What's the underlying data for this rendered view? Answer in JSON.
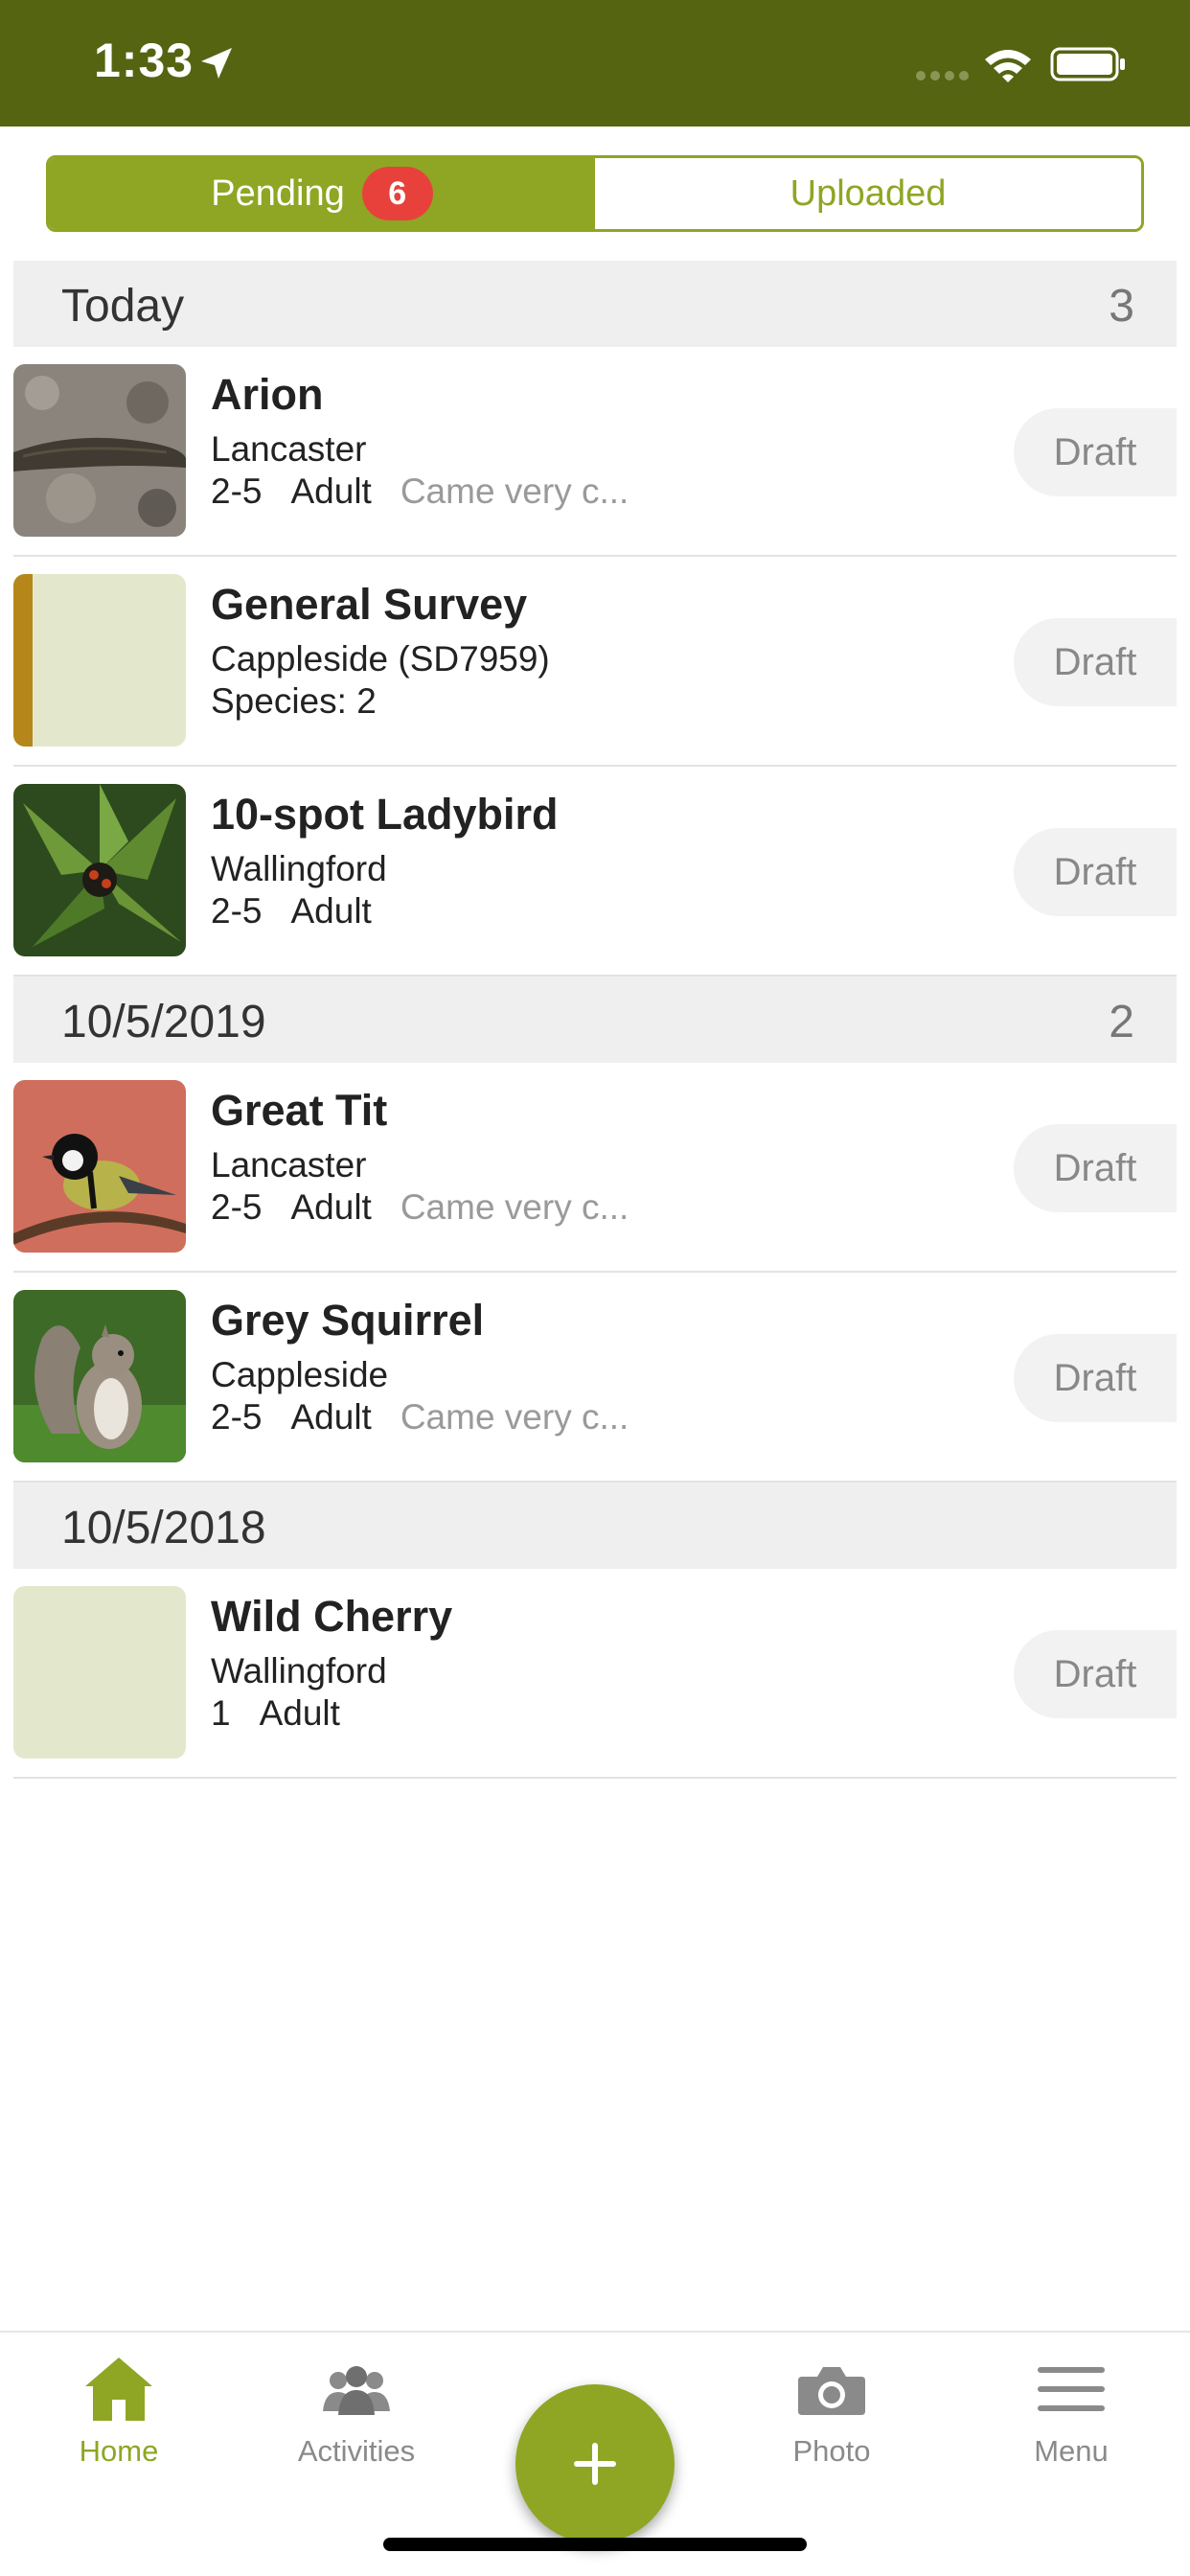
{
  "status_bar": {
    "time": "1:33"
  },
  "tabs": {
    "pending_label": "Pending",
    "pending_count": "6",
    "uploaded_label": "Uploaded"
  },
  "sections": [
    {
      "title": "Today",
      "count": "3"
    },
    {
      "title": "10/5/2019",
      "count": "2"
    },
    {
      "title": "10/5/2018",
      "count": ""
    }
  ],
  "records": [
    {
      "title": "Arion",
      "location": "Lancaster",
      "count": "2-5",
      "stage": "Adult",
      "comment": "Came very c...",
      "status": "Draft"
    },
    {
      "title": "General Survey",
      "location": "Cappleside (SD7959)",
      "species": "Species: 2",
      "status": "Draft"
    },
    {
      "title": "10-spot Ladybird",
      "location": "Wallingford",
      "count": "2-5",
      "stage": "Adult",
      "status": "Draft"
    },
    {
      "title": "Great Tit",
      "location": "Lancaster",
      "count": "2-5",
      "stage": "Adult",
      "comment": "Came very c...",
      "status": "Draft"
    },
    {
      "title": "Grey Squirrel",
      "location": "Cappleside",
      "count": "2-5",
      "stage": "Adult",
      "comment": "Came very c...",
      "status": "Draft"
    },
    {
      "title": "Wild Cherry",
      "location": "Wallingford",
      "count": "1",
      "stage": "Adult",
      "status": "Draft"
    }
  ],
  "tab_bar": {
    "home": "Home",
    "activities": "Activities",
    "photo": "Photo",
    "menu": "Menu"
  },
  "colors": {
    "brand_dark": "#556411",
    "brand": "#8ea623",
    "badge": "#e8413c",
    "survey_strip": "#b5871a"
  }
}
